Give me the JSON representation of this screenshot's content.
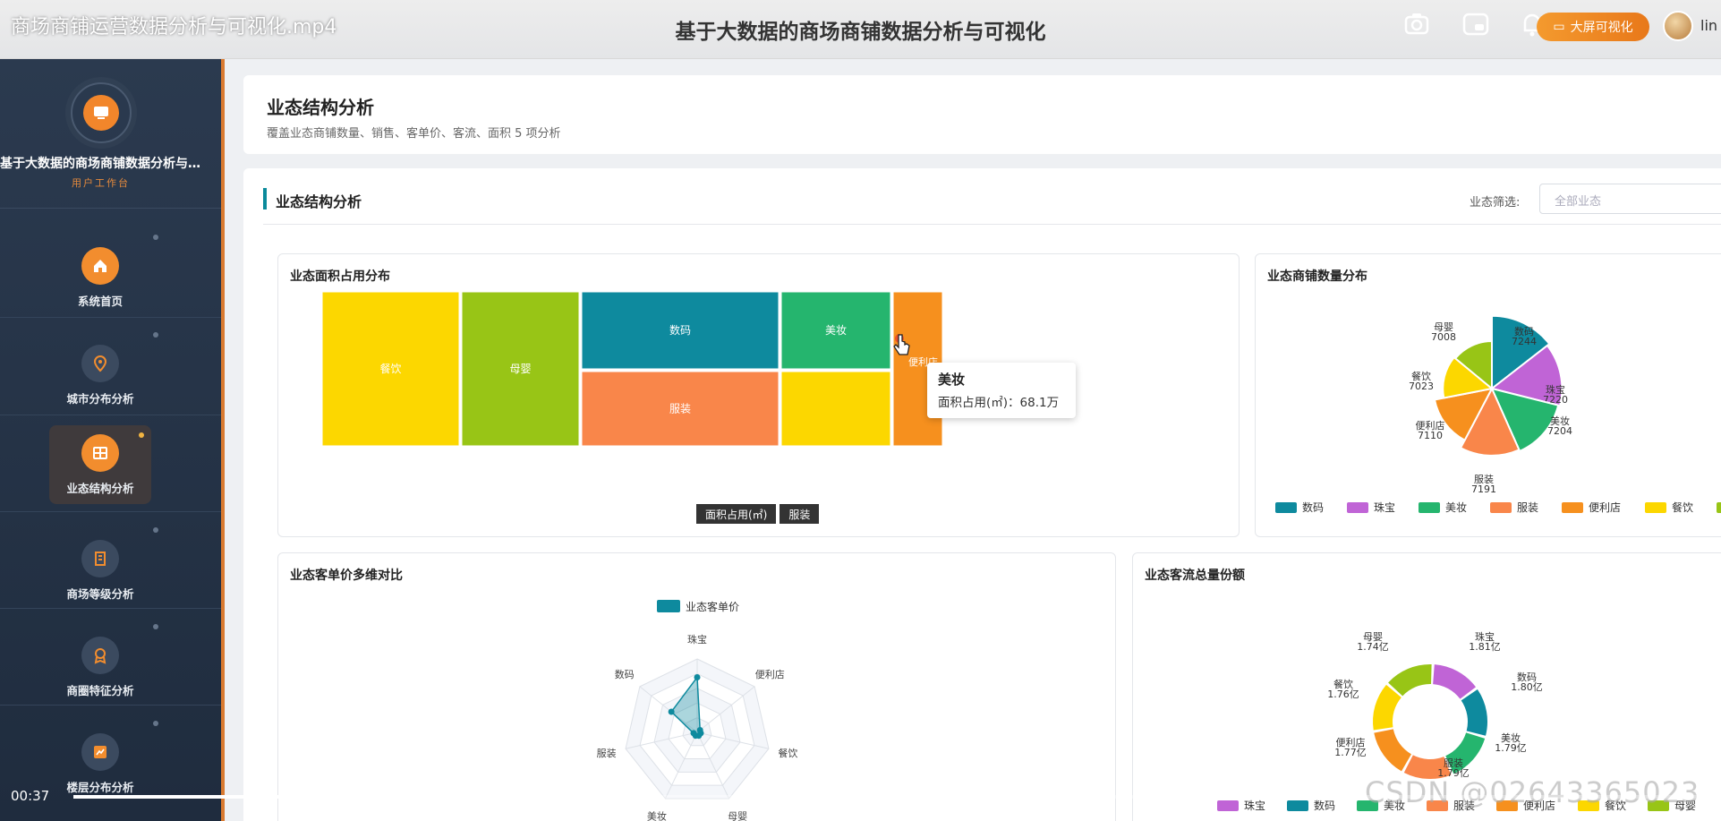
{
  "video": {
    "title": "商场商铺运营数据分析与可视化.mp4",
    "time": "00:37",
    "progress": 0.26
  },
  "app": {
    "title": "基于大数据的商场商铺数据分析与可视化",
    "big_screen_label": "大屏可视化",
    "user": "lin"
  },
  "sidebar": {
    "brand": "基于大数据的商场商铺数据分析与…",
    "subtitle": "用户工作台",
    "items": [
      {
        "label": "系统首页",
        "icon": "home-icon"
      },
      {
        "label": "城市分布分析",
        "icon": "location-pin-icon"
      },
      {
        "label": "业态结构分析",
        "icon": "grid-icon",
        "active": true
      },
      {
        "label": "商场等级分析",
        "icon": "building-icon"
      },
      {
        "label": "商圈特征分析",
        "icon": "badge-icon"
      },
      {
        "label": "楼层分布分析",
        "icon": "chart-icon"
      }
    ]
  },
  "header": {
    "title": "业态结构分析",
    "subtitle": "覆盖业态商铺数量、销售、客单价、客流、面积 5 项分析"
  },
  "section": {
    "title": "业态结构分析",
    "filter_label": "业态筛选:",
    "filter_placeholder": "全部业态"
  },
  "panels": {
    "treemap_title": "业态面积占用分布",
    "pie_title": "业态商铺数量分布",
    "radar_title": "业态客单价多维对比",
    "donut_title": "业态客流总量份额"
  },
  "tooltip": {
    "title": "美妆",
    "label": "面积占用(㎡)：68.1万"
  },
  "breadcrumb": [
    "面积占用(㎡)",
    "服装"
  ],
  "watermark": "CSDN @02643365023",
  "colors": {
    "数码": "#0e8a9e",
    "珠宝": "#c064d6",
    "美妆": "#25b56e",
    "服装": "#f9864a",
    "便利店": "#f6901e",
    "餐饮": "#fcd700",
    "母婴": "#98c516"
  },
  "chart_data": [
    {
      "type": "treemap",
      "title": "业态面积占用分布",
      "items": [
        {
          "name": "餐饮"
        },
        {
          "name": "母婴"
        },
        {
          "name": "数码"
        },
        {
          "name": "服装"
        },
        {
          "name": "美妆",
          "value": "68.1万"
        },
        {
          "name": "便利店"
        },
        {
          "name": ""
        }
      ]
    },
    {
      "type": "pie",
      "title": "业态商铺数量分布",
      "legend": [
        "数码",
        "珠宝",
        "美妆",
        "服装",
        "便利店",
        "餐饮",
        "母婴"
      ],
      "slices": [
        {
          "name": "数码",
          "value": 7244
        },
        {
          "name": "珠宝",
          "value": 7220
        },
        {
          "name": "美妆",
          "value": 7204
        },
        {
          "name": "服装",
          "value": 7191
        },
        {
          "name": "便利店",
          "value": 7110
        },
        {
          "name": "餐饮",
          "value": 7023
        },
        {
          "name": "母婴",
          "value": 7008
        }
      ]
    },
    {
      "type": "radar",
      "title": "业态客单价多维对比",
      "legend": [
        "业态客单价"
      ],
      "axes": [
        "珠宝",
        "便利店",
        "餐饮",
        "母婴",
        "美妆",
        "服装",
        "数码"
      ],
      "values": [
        0.75,
        0.05,
        0.05,
        0.05,
        0.05,
        0.05,
        0.45
      ]
    },
    {
      "type": "donut",
      "title": "业态客流总量份额",
      "legend": [
        "珠宝",
        "数码",
        "美妆",
        "服装",
        "便利店",
        "餐饮",
        "母婴"
      ],
      "slices": [
        {
          "name": "珠宝",
          "value": "1.81亿"
        },
        {
          "name": "数码",
          "value": "1.80亿"
        },
        {
          "name": "美妆",
          "value": "1.79亿"
        },
        {
          "name": "服装",
          "value": "1.79亿"
        },
        {
          "name": "便利店",
          "value": "1.77亿"
        },
        {
          "name": "餐饮",
          "value": "1.76亿"
        },
        {
          "name": "母婴",
          "value": "1.74亿"
        }
      ]
    }
  ]
}
